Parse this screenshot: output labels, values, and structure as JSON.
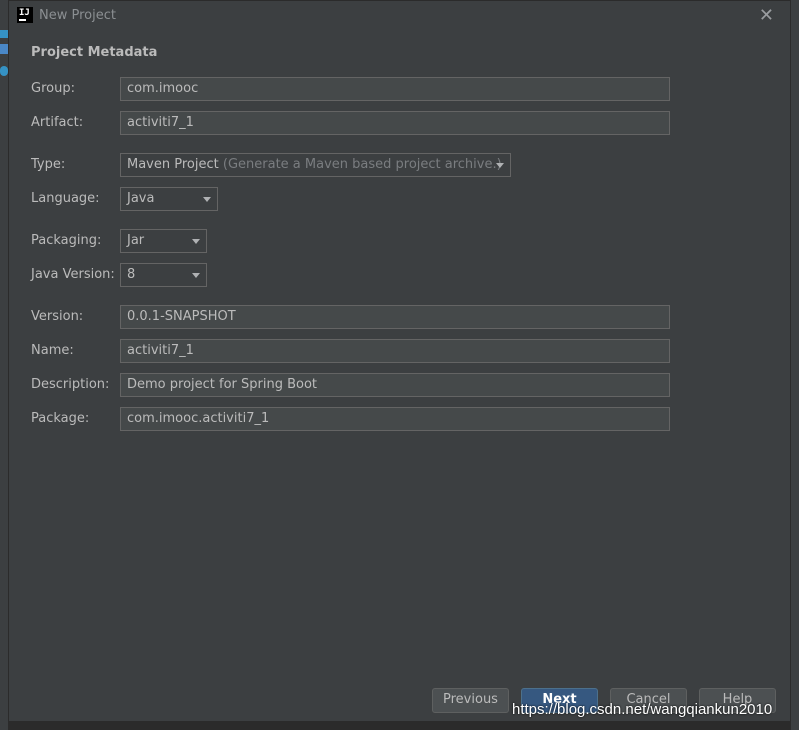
{
  "window": {
    "title": "New Project"
  },
  "section": {
    "title": "Project Metadata"
  },
  "fields": {
    "group": {
      "label": "Group:",
      "value": "com.imooc"
    },
    "artifact": {
      "label": "Artifact:",
      "value": "activiti7_1"
    },
    "type": {
      "label": "Type:",
      "value": "Maven Project",
      "hint": "(Generate a Maven based project archive.)"
    },
    "language": {
      "label": "Language:",
      "value": "Java"
    },
    "packaging": {
      "label": "Packaging:",
      "value": "Jar"
    },
    "java_version": {
      "label": "Java Version:",
      "value": "8"
    },
    "version": {
      "label": "Version:",
      "value": "0.0.1-SNAPSHOT"
    },
    "name": {
      "label": "Name:",
      "value": "activiti7_1"
    },
    "description": {
      "label": "Description:",
      "value": "Demo project for Spring Boot"
    },
    "package": {
      "label": "Package:",
      "value": "com.imooc.activiti7_1"
    }
  },
  "buttons": {
    "previous": "Previous",
    "next": "Next",
    "cancel": "Cancel",
    "help": "Help"
  },
  "watermark": "https://blog.csdn.net/wangqiankun2010",
  "colors": {
    "primary_button": "#365880",
    "background": "#3c3f41"
  }
}
